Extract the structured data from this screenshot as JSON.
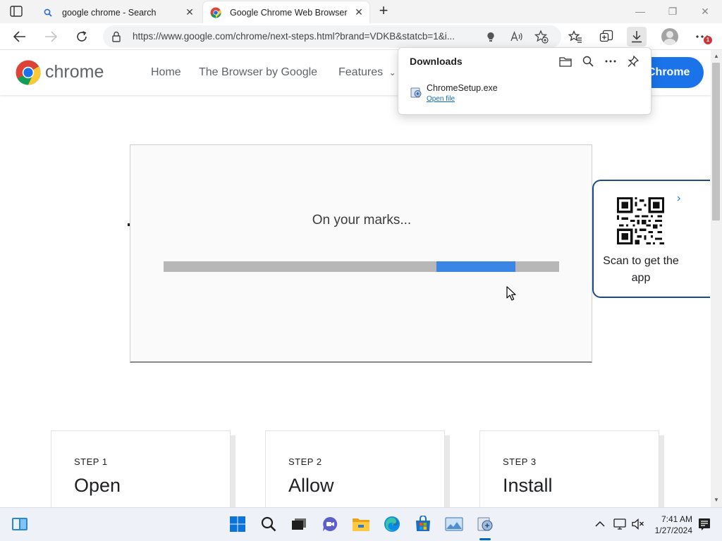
{
  "browser": {
    "tabs": [
      {
        "title": "google chrome - Search",
        "favicon": "search-icon",
        "active": false
      },
      {
        "title": "Google Chrome Web Browser",
        "favicon": "chrome-favicon",
        "active": true
      }
    ],
    "address_bar": {
      "url": "https://www.google.com/chrome/next-steps.html?brand=VDKB&statcb=1&i..."
    },
    "notification_count": "1"
  },
  "downloads_panel": {
    "title": "Downloads",
    "items": [
      {
        "filename": "ChromeSetup.exe",
        "action": "Open file"
      }
    ]
  },
  "site": {
    "brand": "chrome",
    "nav": {
      "home": "Home",
      "browser_by_google": "The Browser by Google",
      "features": "Features"
    },
    "cta_label": "Chrome",
    "install_status": "On your marks...",
    "progress": {
      "segment_start": 0.69,
      "segment_end": 0.89,
      "color": "#3a85e5"
    },
    "qr_card": {
      "label": "Scan to get the app"
    },
    "steps": [
      {
        "label": "STEP 1",
        "title": "Open"
      },
      {
        "label": "STEP 2",
        "title": "Allow"
      },
      {
        "label": "STEP 3",
        "title": "Install"
      }
    ]
  },
  "taskbar": {
    "time": "7:41 AM",
    "date": "1/27/2024",
    "apps": [
      "start-icon",
      "search-icon",
      "task-view-icon",
      "chat-icon",
      "file-explorer-icon",
      "edge-icon",
      "store-icon",
      "photos-icon",
      "setup-installer-icon"
    ]
  },
  "colors": {
    "accent": "#1a73e8",
    "progress_track": "#b7b7b7"
  }
}
